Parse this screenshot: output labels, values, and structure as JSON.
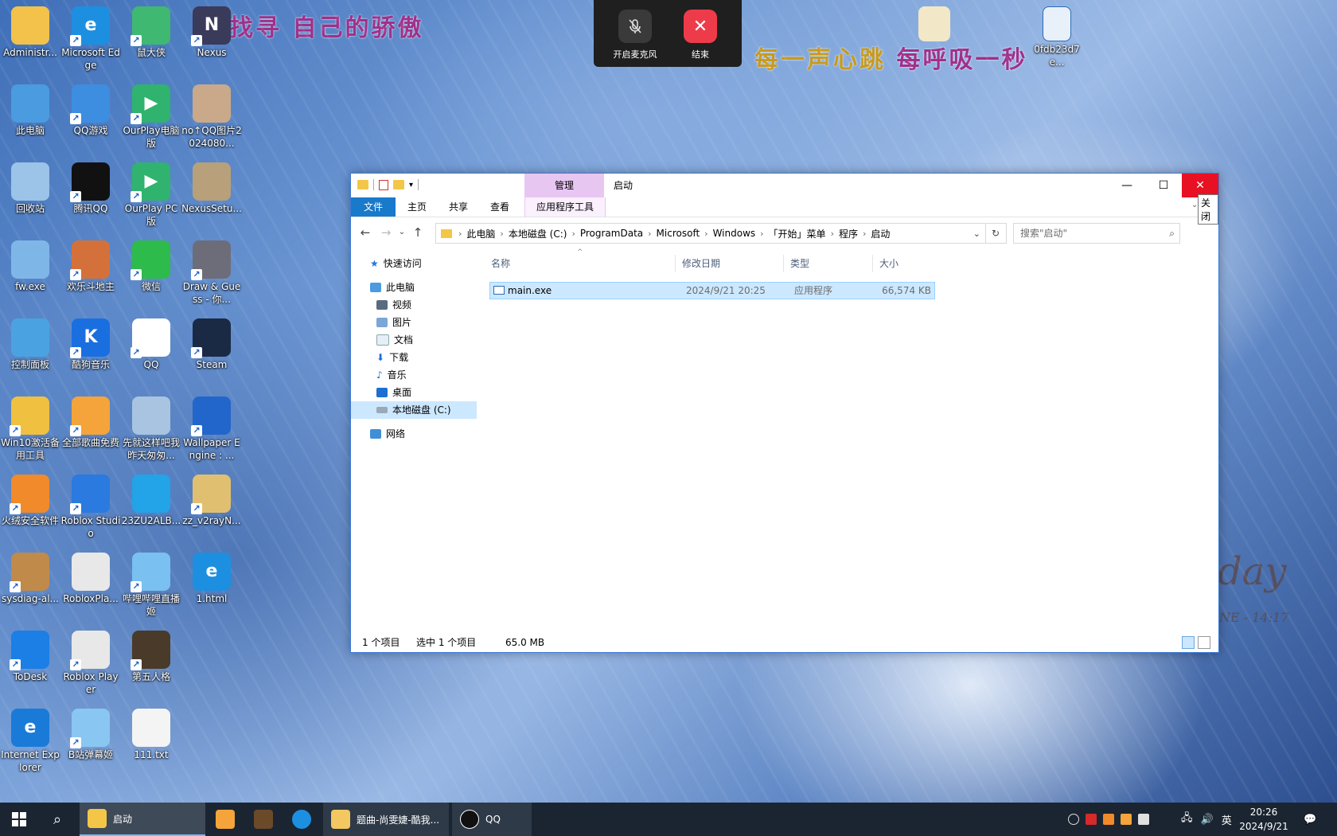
{
  "wallpaper": {
    "lyric_top": "寻找寻  自己的骄傲",
    "lyric_mid_a": "每一声心跳",
    "lyric_mid_b": "每呼吸一秒",
    "deco": "day",
    "deco_sub": "NE - 14:17"
  },
  "desktop_icons": [
    {
      "label": "Administr...",
      "color": "#f2c24a",
      "glyph": "",
      "shortcut": false
    },
    {
      "label": "Microsoft Edge",
      "color": "#1d8fe0",
      "glyph": "e",
      "shortcut": true
    },
    {
      "label": "鼠大侠",
      "color": "#3fb872",
      "glyph": "",
      "shortcut": true
    },
    {
      "label": "Nexus",
      "color": "#3a3a5a",
      "glyph": "N",
      "shortcut": true
    },
    {
      "label": "此电脑",
      "color": "#4a9be0",
      "glyph": "",
      "shortcut": false
    },
    {
      "label": "QQ游戏",
      "color": "#3d8ee0",
      "glyph": "",
      "shortcut": true
    },
    {
      "label": "OurPlay电脑版",
      "color": "#2fb36e",
      "glyph": "▶",
      "shortcut": true
    },
    {
      "label": "no↑QQ图片2024080...",
      "color": "#c9a98a",
      "glyph": "",
      "shortcut": false
    },
    {
      "label": "回收站",
      "color": "#9cc3e8",
      "glyph": "",
      "shortcut": false
    },
    {
      "label": "腾讯QQ",
      "color": "#111111",
      "glyph": "",
      "shortcut": true
    },
    {
      "label": "OurPlay PC版",
      "color": "#2fb36e",
      "glyph": "▶",
      "shortcut": true
    },
    {
      "label": "NexusSetu...",
      "color": "#b8a07a",
      "glyph": "",
      "shortcut": false
    },
    {
      "label": "fw.exe",
      "color": "#7fb6e8",
      "glyph": "",
      "shortcut": false
    },
    {
      "label": "欢乐斗地主",
      "color": "#d4713a",
      "glyph": "",
      "shortcut": true
    },
    {
      "label": "微信",
      "color": "#2dbb4c",
      "glyph": "",
      "shortcut": true
    },
    {
      "label": "Draw & Guess - 你...",
      "color": "#6d6d7a",
      "glyph": "",
      "shortcut": true
    },
    {
      "label": "控制面板",
      "color": "#4aa3e0",
      "glyph": "",
      "shortcut": false
    },
    {
      "label": "酷狗音乐",
      "color": "#1a6fe0",
      "glyph": "K",
      "shortcut": true
    },
    {
      "label": "QQ",
      "color": "#ffffff",
      "glyph": "",
      "shortcut": true
    },
    {
      "label": "Steam",
      "color": "#1b2a44",
      "glyph": "",
      "shortcut": true
    },
    {
      "label": "Win10激活备用工具",
      "color": "#f0c040",
      "glyph": "",
      "shortcut": true
    },
    {
      "label": "全部歌曲免费",
      "color": "#f4a43a",
      "glyph": "",
      "shortcut": true
    },
    {
      "label": "先就这样吧我昨天匆匆...",
      "color": "#a8c4e0",
      "glyph": "",
      "shortcut": false
    },
    {
      "label": "Wallpaper Engine : ...",
      "color": "#2266cc",
      "glyph": "",
      "shortcut": true
    },
    {
      "label": "火绒安全软件",
      "color": "#f08a2a",
      "glyph": "",
      "shortcut": true
    },
    {
      "label": "Roblox Studio",
      "color": "#2a7ae0",
      "glyph": "",
      "shortcut": true
    },
    {
      "label": "23ZU2ALB...",
      "color": "#23a3e8",
      "glyph": "",
      "shortcut": false
    },
    {
      "label": "zz_v2rayN...",
      "color": "#e0c070",
      "glyph": "",
      "shortcut": true
    },
    {
      "label": "sysdiag-al...",
      "color": "#c08a4a",
      "glyph": "",
      "shortcut": true
    },
    {
      "label": "RobloxPla...",
      "color": "#e8e8e8",
      "glyph": "",
      "shortcut": false
    },
    {
      "label": "哔哩哔哩直播姬",
      "color": "#7ac0f0",
      "glyph": "",
      "shortcut": true
    },
    {
      "label": "1.html",
      "color": "#1d8fe0",
      "glyph": "e",
      "shortcut": false
    },
    {
      "label": "ToDesk",
      "color": "#1b7fe6",
      "glyph": "",
      "shortcut": true
    },
    {
      "label": "Roblox Player",
      "color": "#e8e8e8",
      "glyph": "",
      "shortcut": true
    },
    {
      "label": "第五人格",
      "color": "#4a3a2a",
      "glyph": "",
      "shortcut": true
    },
    {
      "label": "",
      "color": "transparent",
      "glyph": "",
      "shortcut": false
    },
    {
      "label": "Internet Explorer",
      "color": "#1a7ad8",
      "glyph": "e",
      "shortcut": false
    },
    {
      "label": "B站弹幕姬",
      "color": "#8ac6f2",
      "glyph": "",
      "shortcut": true
    },
    {
      "label": "111.txt",
      "color": "#f4f4f4",
      "glyph": "",
      "shortcut": false
    }
  ],
  "desktop_top_files": [
    {
      "label": ""
    },
    {
      "label": "0fdb23d7e..."
    }
  ],
  "meeting": {
    "mic_label": "开启麦克风",
    "end_label": "结束"
  },
  "explorer": {
    "title": "启动",
    "manage_tab": "管理",
    "tabs": {
      "file": "文件",
      "home": "主页",
      "share": "共享",
      "view": "查看",
      "apptools": "应用程序工具"
    },
    "close_tooltip": "关闭",
    "breadcrumb": [
      "此电脑",
      "本地磁盘 (C:)",
      "ProgramData",
      "Microsoft",
      "Windows",
      "「开始」菜单",
      "程序",
      "启动"
    ],
    "search_placeholder": "搜索\"启动\"",
    "nav": {
      "quick_access": "快速访问",
      "this_pc": "此电脑",
      "videos": "视频",
      "pictures": "图片",
      "documents": "文档",
      "downloads": "下载",
      "music": "音乐",
      "desktop": "桌面",
      "local_disk": "本地磁盘 (C:)",
      "network": "网络"
    },
    "columns": {
      "name": "名称",
      "modified": "修改日期",
      "type": "类型",
      "size": "大小"
    },
    "files": [
      {
        "name": "main.exe",
        "modified": "2024/9/21 20:25",
        "type": "应用程序",
        "size": "66,574 KB"
      }
    ],
    "status": {
      "count": "1 个项目",
      "selected": "选中 1 个项目",
      "size": "65.0 MB"
    }
  },
  "taskbar": {
    "explorer_label": "启动",
    "music_label": "题曲-尚雯婕-酷我...",
    "qq_label": "QQ",
    "ime": "英",
    "time": "20:26",
    "date": "2024/9/21"
  }
}
